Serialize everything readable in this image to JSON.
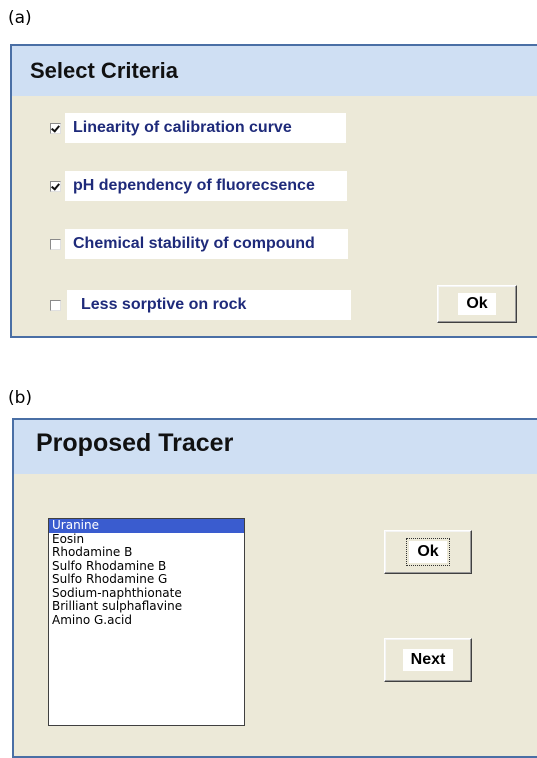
{
  "figure_a": {
    "label": "(a)",
    "title": "Select Criteria",
    "criteria": [
      {
        "label": "Linearity of calibration curve",
        "checked": true
      },
      {
        "label": "pH dependency of fluorecsence",
        "checked": true
      },
      {
        "label": "Chemical stability of compound",
        "checked": false
      },
      {
        "label": "Less sorptive on rock",
        "checked": false
      }
    ],
    "ok_label": "Ok"
  },
  "figure_b": {
    "label": "(b)",
    "title": "Proposed Tracer",
    "tracers": [
      "Uranine",
      "Eosin",
      "Rhodamine B",
      "Sulfo Rhodamine B",
      "Sulfo Rhodamine G",
      "Sodium-naphthionate",
      "Brilliant sulphaflavine",
      "Amino G.acid"
    ],
    "selected_tracer": "Uranine",
    "ok_label": "Ok",
    "next_label": "Next"
  },
  "colors": {
    "panel_bg": "#ece9d8",
    "title_bar": "#cfdff3",
    "panel_border": "#4a6fa5",
    "label_text": "#1e2a7a",
    "selection": "#3a5ccf"
  }
}
